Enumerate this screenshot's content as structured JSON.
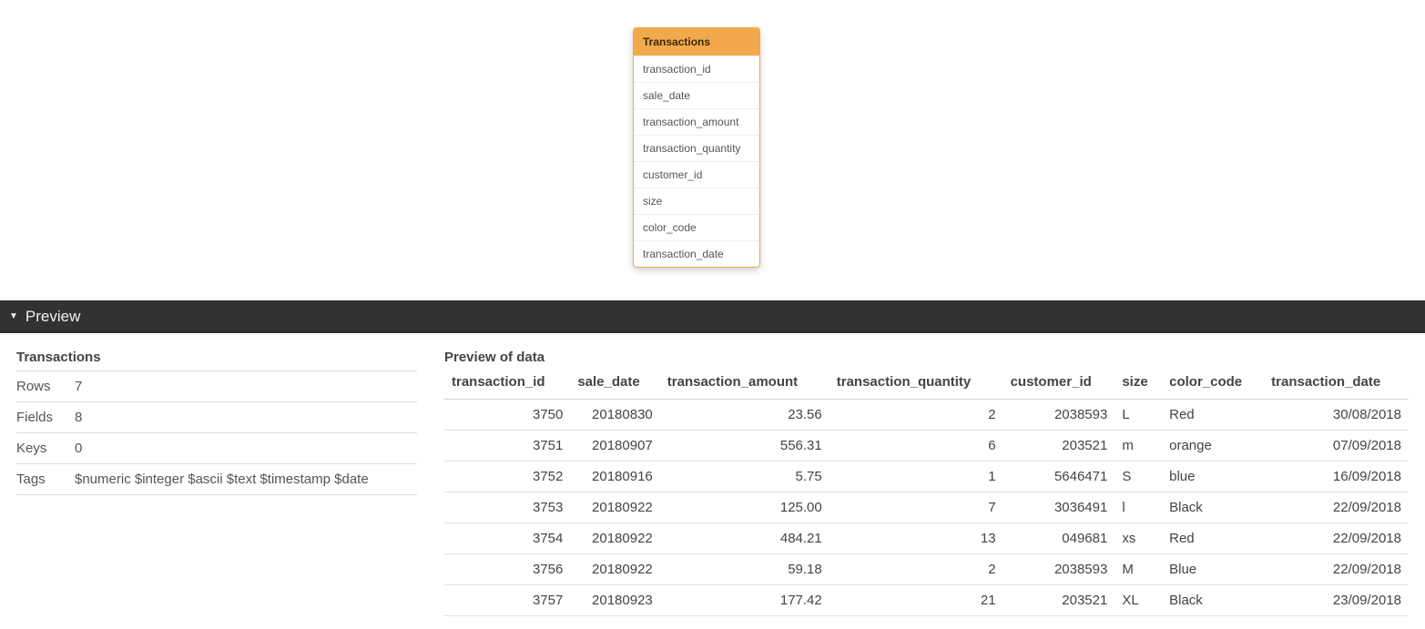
{
  "entity_card": {
    "title": "Transactions",
    "fields": [
      "transaction_id",
      "sale_date",
      "transaction_amount",
      "transaction_quantity",
      "customer_id",
      "size",
      "color_code",
      "transaction_date"
    ]
  },
  "preview": {
    "bar_label": "Preview",
    "meta_title": "Transactions",
    "meta": {
      "rows_label": "Rows",
      "rows_value": "7",
      "fields_label": "Fields",
      "fields_value": "8",
      "keys_label": "Keys",
      "keys_value": "0",
      "tags_label": "Tags",
      "tags_value": "$numeric $integer $ascii $text $timestamp $date"
    },
    "data_title": "Preview of data",
    "columns": [
      {
        "name": "transaction_id",
        "align": "num"
      },
      {
        "name": "sale_date",
        "align": "num"
      },
      {
        "name": "transaction_amount",
        "align": "num"
      },
      {
        "name": "transaction_quantity",
        "align": "num"
      },
      {
        "name": "customer_id",
        "align": "num"
      },
      {
        "name": "size",
        "align": "txt"
      },
      {
        "name": "color_code",
        "align": "txt"
      },
      {
        "name": "transaction_date",
        "align": "num"
      }
    ],
    "rows": [
      [
        "3750",
        "20180830",
        "23.56",
        "2",
        "2038593",
        "L",
        "Red",
        "30/08/2018"
      ],
      [
        "3751",
        "20180907",
        "556.31",
        "6",
        "203521",
        "m",
        "orange",
        "07/09/2018"
      ],
      [
        "3752",
        "20180916",
        "5.75",
        "1",
        "5646471",
        "S",
        "blue",
        "16/09/2018"
      ],
      [
        "3753",
        "20180922",
        "125.00",
        "7",
        "3036491",
        "l",
        "Black",
        "22/09/2018"
      ],
      [
        "3754",
        "20180922",
        "484.21",
        "13",
        "049681",
        "xs",
        "Red",
        "22/09/2018"
      ],
      [
        "3756",
        "20180922",
        "59.18",
        "2",
        "2038593",
        "M",
        "Blue",
        "22/09/2018"
      ],
      [
        "3757",
        "20180923",
        "177.42",
        "21",
        "203521",
        "XL",
        "Black",
        "23/09/2018"
      ]
    ]
  }
}
